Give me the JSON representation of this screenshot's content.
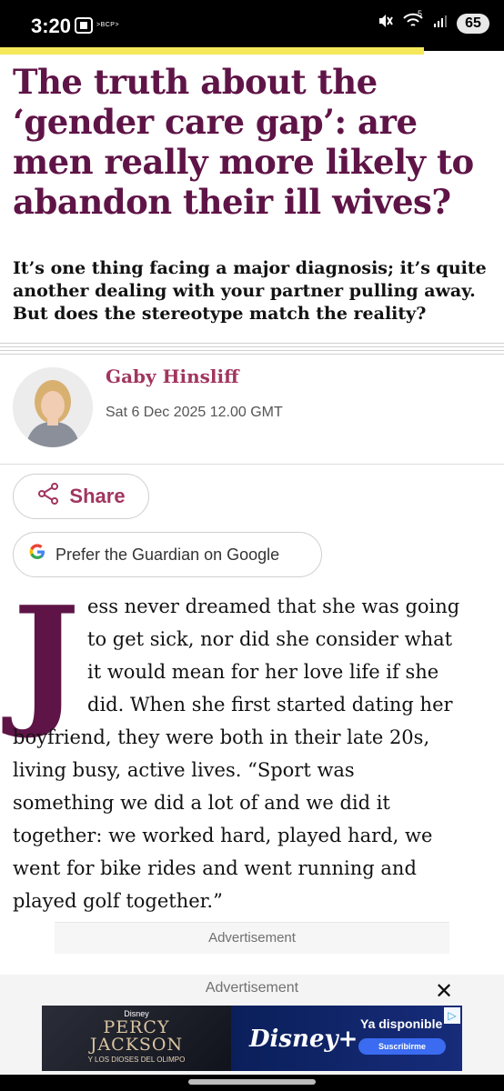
{
  "status_bar": {
    "time": "3:20",
    "carrier_badge": ">BCP>",
    "network": "5",
    "battery": "65",
    "icons": [
      "screen-record-icon",
      "mute-vibrate-icon",
      "wifi-icon",
      "signal-icon"
    ]
  },
  "article": {
    "headline": "The truth about the ‘gender care gap’: are men really more likely to abandon their ill wives?",
    "standfirst": "It’s one thing facing a major diagnosis; it’s quite another dealing with your partner pulling away. But does the stereotype match the reality?",
    "author": "Gaby Hinsliff",
    "date": "Sat 6 Dec 2025 12.00 GMT",
    "share_label": "Share",
    "google_prefer_label": "Prefer the Guardian on Google",
    "dropcap": "J",
    "body_lines": [
      "ess never dreamed that she was going",
      "to get sick, nor did she consider what",
      "it would mean for her love life if she",
      "did. When she first started dating her",
      "boyfriend, they were both in their late 20s,",
      "living busy, active lives. “Sport was",
      "something we did a lot of and we did it",
      "together: we worked hard, played hard, we",
      "went for bike rides and went running and",
      "played golf together.”"
    ]
  },
  "ads": {
    "inline_label": "Advertisement",
    "bottom_label": "Advertisement",
    "close_symbol": "✕",
    "banner": {
      "disney_small": "Disney",
      "title_line1": "PERCY",
      "title_line2": "JACKSON",
      "subtitle": "Y LOS DIOSES DEL OLIMPO",
      "brand": "Disney+",
      "availability": "Ya disponible",
      "cta": "Suscribirme",
      "adchoice_symbol": "▷"
    }
  },
  "colors": {
    "headline": "#5f1447",
    "author": "#a1355f",
    "progress_bar": "#f5e85a"
  }
}
